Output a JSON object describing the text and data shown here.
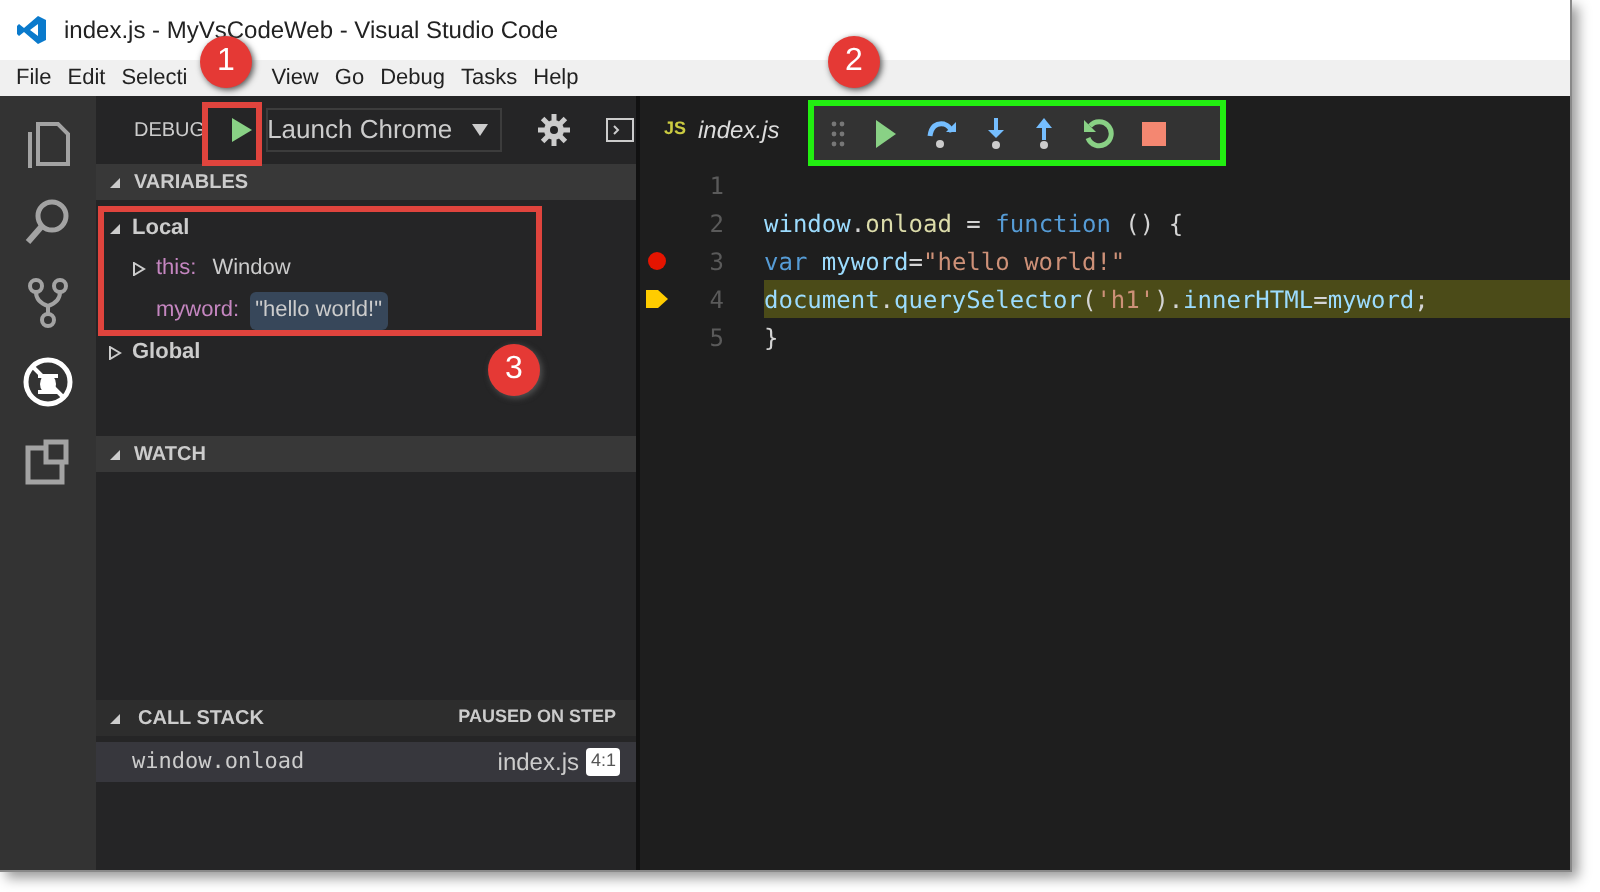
{
  "window": {
    "title": "index.js - MyVsCodeWeb - Visual Studio Code"
  },
  "menu": [
    "File",
    "Edit",
    "Selecti",
    "View",
    "Go",
    "Debug",
    "Tasks",
    "Help"
  ],
  "activity_bar": [
    {
      "kind": "files",
      "selected": false
    },
    {
      "kind": "search",
      "selected": false
    },
    {
      "kind": "git",
      "selected": false
    },
    {
      "kind": "debug",
      "selected": true
    },
    {
      "kind": "extensions",
      "selected": false
    }
  ],
  "debug_header": {
    "title": "DEBUG",
    "configuration": "Launch Chrome"
  },
  "variables": {
    "title": "VARIABLES",
    "expanded": true,
    "scopes": [
      {
        "label": "Local",
        "expanded": true,
        "children": [
          {
            "name": "this:",
            "value": "Window",
            "expanded": false,
            "selected": false
          },
          {
            "name": "myword:",
            "value": "\"hello world!\"",
            "selected": true
          }
        ]
      },
      {
        "label": "Global",
        "expanded": false
      }
    ]
  },
  "watch": {
    "title": "WATCH",
    "expanded": true
  },
  "call_stack": {
    "title": "CALL STACK",
    "expanded": true,
    "status": "PAUSED ON STEP",
    "frames": [
      {
        "name": "window.onload",
        "file": "index.js",
        "position": "4:1",
        "selected": true
      }
    ]
  },
  "editor": {
    "tab": {
      "icon": "JS",
      "label": "index.js"
    },
    "lines": [
      {
        "number": "1",
        "breakpoint": false,
        "current": false
      },
      {
        "number": "2",
        "breakpoint": false,
        "current": false,
        "tokens": [
          {
            "kind": "var",
            "text": "window"
          },
          {
            "kind": "plain",
            "text": "."
          },
          {
            "kind": "fn",
            "text": "onload"
          },
          {
            "kind": "plain",
            "text": " = "
          },
          {
            "kind": "kw",
            "text": "function"
          },
          {
            "kind": "plain",
            "text": " () {"
          }
        ]
      },
      {
        "number": "3",
        "breakpoint": true,
        "current": false,
        "tokens": [
          {
            "kind": "kw",
            "text": "var"
          },
          {
            "kind": "var",
            "text": " myword"
          },
          {
            "kind": "plain",
            "text": "="
          },
          {
            "kind": "str",
            "text": "\"hello world!\""
          }
        ]
      },
      {
        "number": "4",
        "breakpoint": false,
        "current": true,
        "tokens": [
          {
            "kind": "var",
            "text": "document"
          },
          {
            "kind": "plain",
            "text": "."
          },
          {
            "kind": "var",
            "text": "querySelector"
          },
          {
            "kind": "plain",
            "text": "("
          },
          {
            "kind": "str",
            "text": "'h1'"
          },
          {
            "kind": "plain",
            "text": ")."
          },
          {
            "kind": "var",
            "text": "innerHTML"
          },
          {
            "kind": "plain",
            "text": "="
          },
          {
            "kind": "var",
            "text": "myword"
          },
          {
            "kind": "plain",
            "text": ";"
          }
        ]
      },
      {
        "number": "5",
        "breakpoint": false,
        "current": false,
        "tokens": [
          {
            "kind": "plain",
            "text": "}"
          }
        ]
      }
    ]
  },
  "annotations": [
    {
      "label": "1"
    },
    {
      "label": "2"
    },
    {
      "label": "3"
    }
  ]
}
